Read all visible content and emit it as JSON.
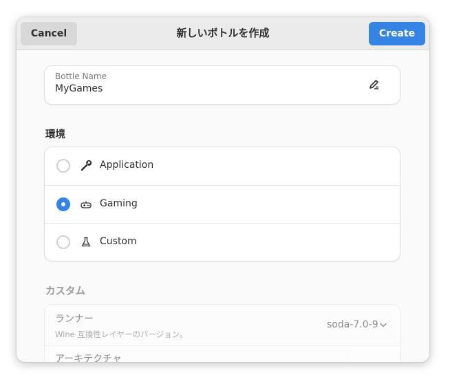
{
  "header": {
    "cancel_label": "Cancel",
    "title": "新しいボトルを作成",
    "create_label": "Create"
  },
  "name_field": {
    "label": "Bottle Name",
    "value": "MyGames",
    "icon": "edit-icon"
  },
  "environment": {
    "title": "環境",
    "options": [
      {
        "label": "Application",
        "icon": "wrench-icon",
        "selected": false
      },
      {
        "label": "Gaming",
        "icon": "gamepad-icon",
        "selected": true
      },
      {
        "label": "Custom",
        "icon": "flask-icon",
        "selected": false
      }
    ]
  },
  "custom": {
    "title": "カスタム",
    "runner": {
      "title": "ランナー",
      "subtitle": "Wine 互換性レイヤーのバージョン。",
      "value": "soda-7.0-9"
    },
    "architecture": {
      "title": "アーキテクチャ"
    }
  },
  "colors": {
    "accent": "#3584e4",
    "headerbar": "#ebebeb",
    "background": "#fafafa"
  }
}
